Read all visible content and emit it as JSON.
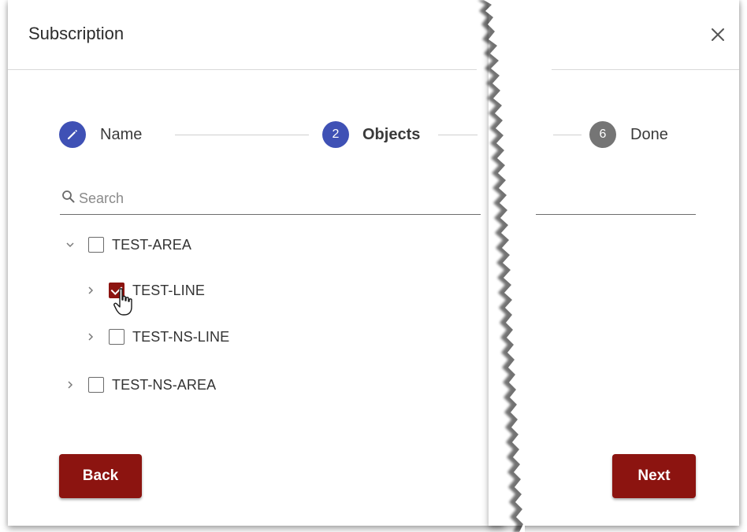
{
  "dialog": {
    "title": "Subscription"
  },
  "stepper": {
    "steps": [
      {
        "label": "Name",
        "badge": "",
        "icon": "pencil-icon",
        "state": "edited",
        "color": "#3f51b5"
      },
      {
        "label": "Objects",
        "badge": "2",
        "state": "active",
        "color": "#3f51b5"
      },
      {
        "label": "Done",
        "badge": "6",
        "state": "inactive",
        "color": "#757575"
      }
    ]
  },
  "search": {
    "placeholder": "Search",
    "value": ""
  },
  "tree": {
    "nodes": [
      {
        "label": "TEST-AREA",
        "expanded": true,
        "checked": false,
        "level": 0
      },
      {
        "label": "TEST-LINE",
        "expanded": false,
        "checked": true,
        "level": 1
      },
      {
        "label": "TEST-NS-LINE",
        "expanded": false,
        "checked": false,
        "level": 1
      },
      {
        "label": "TEST-NS-AREA",
        "expanded": false,
        "checked": false,
        "level": 0
      }
    ]
  },
  "actions": {
    "back_label": "Back",
    "next_label": "Next"
  },
  "colors": {
    "accent": "#8c1410",
    "step": "#3f51b5",
    "step_inactive": "#757575"
  }
}
